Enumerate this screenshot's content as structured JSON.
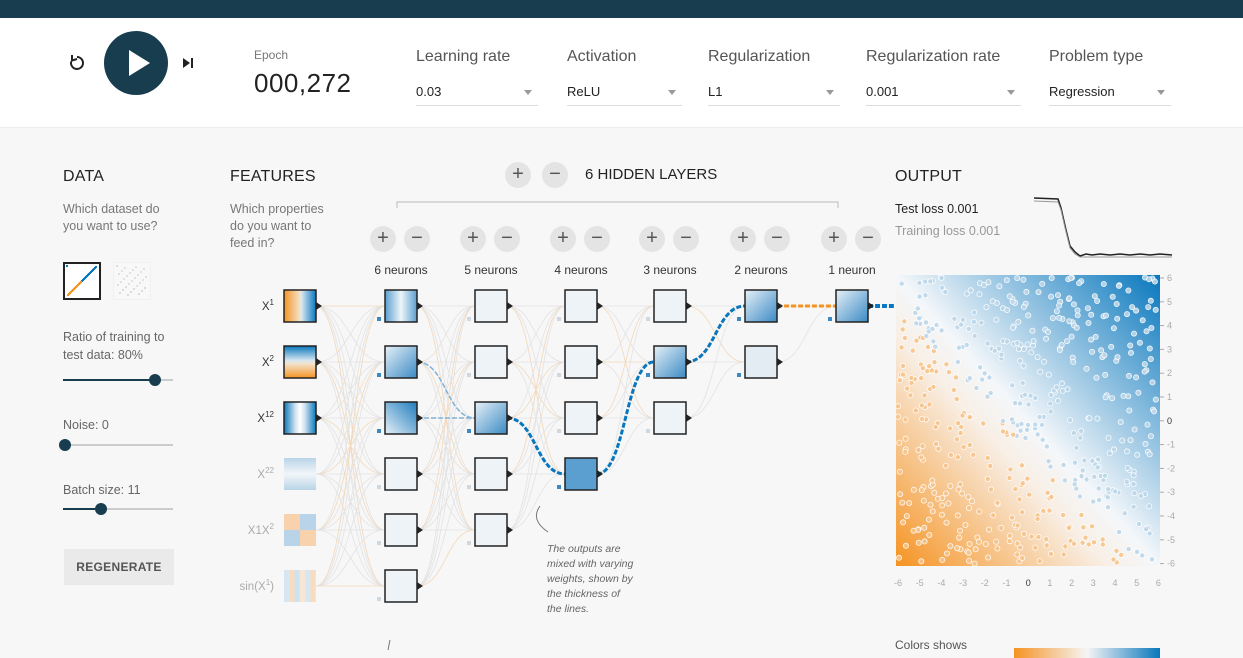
{
  "header": {
    "epoch_label": "Epoch",
    "epoch_value": "000,272",
    "learning_rate": {
      "label": "Learning rate",
      "value": "0.03"
    },
    "activation": {
      "label": "Activation",
      "value": "ReLU"
    },
    "regularization": {
      "label": "Regularization",
      "value": "L1"
    },
    "regularization_rate": {
      "label": "Regularization rate",
      "value": "0.001"
    },
    "problem_type": {
      "label": "Problem type",
      "value": "Regression"
    }
  },
  "data_panel": {
    "title": "DATA",
    "subtitle_1": "Which dataset do",
    "subtitle_2": "you want to use?",
    "ratio_label_1": "Ratio of training to",
    "ratio_label_2": "test data:  80%",
    "ratio_percent": 80,
    "noise_label": "Noise:  0",
    "noise_value": 0,
    "batch_label": "Batch size:  11",
    "batch_value": 11,
    "regenerate_label": "REGENERATE"
  },
  "features_panel": {
    "title": "FEATURES",
    "subtitle_1": "Which properties",
    "subtitle_2": "do you want to",
    "subtitle_3": "feed in?",
    "features": [
      {
        "name": "X1",
        "base": "X",
        "sup": "1",
        "active": true
      },
      {
        "name": "X2",
        "base": "X",
        "sup": "2",
        "active": true
      },
      {
        "name": "X12",
        "base": "X",
        "sup": "12",
        "active": true
      },
      {
        "name": "X22",
        "base": "X",
        "sup": "22",
        "active": false
      },
      {
        "name": "X1X2",
        "base": "X1X",
        "sup": "2",
        "active": false
      },
      {
        "name": "sin(X1)",
        "base": "sin(X",
        "sup": "1",
        "suffix": ")",
        "active": false
      }
    ]
  },
  "network": {
    "hidden_layers_label": "6  HIDDEN LAYERS",
    "layers": [
      {
        "neurons_label": "6 neurons",
        "count": 6
      },
      {
        "neurons_label": "5 neurons",
        "count": 5
      },
      {
        "neurons_label": "4 neurons",
        "count": 4
      },
      {
        "neurons_label": "3 neurons",
        "count": 3
      },
      {
        "neurons_label": "2 neurons",
        "count": 2
      },
      {
        "neurons_label": "1 neuron",
        "count": 1
      }
    ],
    "note": [
      "The outputs are",
      "mixed with varying",
      "weights, shown by",
      "the thickness of",
      "the lines."
    ]
  },
  "output_panel": {
    "title": "OUTPUT",
    "test_loss_label": "Test loss",
    "test_loss_value": "0.001",
    "training_loss_label": "Training loss",
    "training_loss_value": "0.001",
    "colors_shows": "Colors shows",
    "x_ticks": [
      "-6",
      "-5",
      "-4",
      "-3",
      "-2",
      "-1",
      "0",
      "1",
      "2",
      "3",
      "4",
      "5",
      "6"
    ],
    "y_ticks": [
      "6",
      "5",
      "4",
      "3",
      "2",
      "1",
      "0",
      "-1",
      "-2",
      "-3",
      "-4",
      "-5",
      "-6"
    ]
  },
  "colors": {
    "dark": "#183d4e",
    "orange": "#f59322",
    "blue": "#0877bd"
  }
}
